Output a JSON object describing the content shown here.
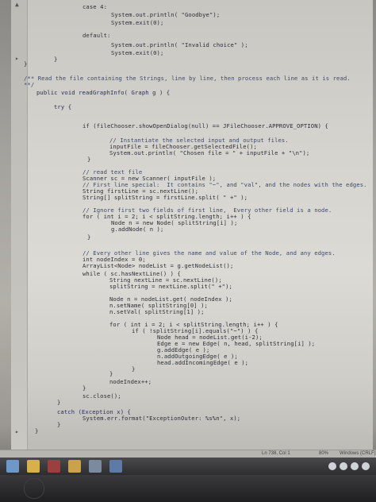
{
  "editor": {
    "lines": [
      {
        "text": "case 4:",
        "cls": ""
      },
      {
        "text": "System.out.println( \"Goodbye\");",
        "cls": ""
      },
      {
        "text": "System.exit(0);",
        "cls": ""
      },
      {
        "text": "default:",
        "cls": ""
      },
      {
        "text": "System.out.println( \"Invalid choice\" );",
        "cls": ""
      },
      {
        "text": "System.exit(0);",
        "cls": ""
      },
      {
        "text": "}",
        "cls": ""
      },
      {
        "text": "}",
        "cls": ""
      },
      {
        "text": "/** Read the file containing the Strings, line by line, then process each line as it is read.",
        "cls": "comment"
      },
      {
        "text": "**/",
        "cls": "comment"
      },
      {
        "text": "public void readGraphInfo( Graph g ) {",
        "cls": "kw"
      },
      {
        "text": "try {",
        "cls": "kw"
      },
      {
        "text": "if (fileChooser.showOpenDialog(null) == JFileChooser.APPROVE_OPTION) {",
        "cls": ""
      },
      {
        "text": "// Instantiate the selected input and output files.",
        "cls": "comment"
      },
      {
        "text": "inputFile = fileChooser.getSelectedFile();",
        "cls": ""
      },
      {
        "text": "System.out.println( \"Chosen file = \" + inputFile + \"\\n\");",
        "cls": ""
      },
      {
        "text": "}",
        "cls": ""
      },
      {
        "text": "// read text file",
        "cls": "comment"
      },
      {
        "text": "Scanner sc = new Scanner( inputFile );",
        "cls": ""
      },
      {
        "text": "// First line special:  It contains \"~\", and \"val\", and the nodes with the edges.",
        "cls": "comment"
      },
      {
        "text": "String firstLine = sc.nextLine();",
        "cls": ""
      },
      {
        "text": "String[] splitString = firstLine.split( \" +\" );",
        "cls": ""
      },
      {
        "text": "// Ignore first two fields of first line,  Every other field is a node.",
        "cls": "comment"
      },
      {
        "text": "for ( int i = 2; i < splitString.length; i++ ) {",
        "cls": ""
      },
      {
        "text": "Node n = new Node( splitString[i] );",
        "cls": ""
      },
      {
        "text": "g.addNode( n );",
        "cls": ""
      },
      {
        "text": "}",
        "cls": ""
      },
      {
        "text": "// Every other line gives the name and value of the Node, and any edges.",
        "cls": "comment"
      },
      {
        "text": "int nodeIndex = 0;",
        "cls": ""
      },
      {
        "text": "ArrayList<Node> nodeList = g.getNodeList();",
        "cls": ""
      },
      {
        "text": "while ( sc.hasNextLine() ) {",
        "cls": ""
      },
      {
        "text": "String nextLine = sc.nextLine();",
        "cls": ""
      },
      {
        "text": "splitString = nextLine.split(\" +\");",
        "cls": ""
      },
      {
        "text": "Node n = nodeList.get( nodeIndex );",
        "cls": ""
      },
      {
        "text": "n.setName( splitString[0] );",
        "cls": ""
      },
      {
        "text": "n.setVal( splitString[1] );",
        "cls": ""
      },
      {
        "text": "for ( int i = 2; i < splitString.length; i++ ) {",
        "cls": ""
      },
      {
        "text": "if ( !splitString[i].equals(\"~\") ) {",
        "cls": ""
      },
      {
        "text": "Node head = nodeList.get(i-2);",
        "cls": ""
      },
      {
        "text": "Edge e = new Edge( n, head, splitString[i] );",
        "cls": ""
      },
      {
        "text": "g.addEdge( e );",
        "cls": ""
      },
      {
        "text": "n.addOutgoingEdge( e );",
        "cls": ""
      },
      {
        "text": "head.addIncomingEdge( e );",
        "cls": ""
      },
      {
        "text": "}",
        "cls": ""
      },
      {
        "text": "}",
        "cls": ""
      },
      {
        "text": "nodeIndex++;",
        "cls": ""
      },
      {
        "text": "}",
        "cls": ""
      },
      {
        "text": "sc.close();",
        "cls": ""
      },
      {
        "text": "}",
        "cls": ""
      },
      {
        "text": "catch (Exception x) {",
        "cls": "kw"
      },
      {
        "text": "System.err.format(\"ExceptionOuter: %s%n\", x);",
        "cls": ""
      },
      {
        "text": "}",
        "cls": ""
      },
      {
        "text": "}",
        "cls": ""
      }
    ]
  },
  "statusbar": {
    "position": "Ln 738, Col 1",
    "zoom": "80%",
    "line_ending": "Windows (CRLF)"
  },
  "taskbar": {
    "icons": [
      "start-icon",
      "file-explorer-icon",
      "store-icon",
      "acrobat-icon",
      "folder-icon",
      "app-icon",
      "browser-icon"
    ]
  }
}
